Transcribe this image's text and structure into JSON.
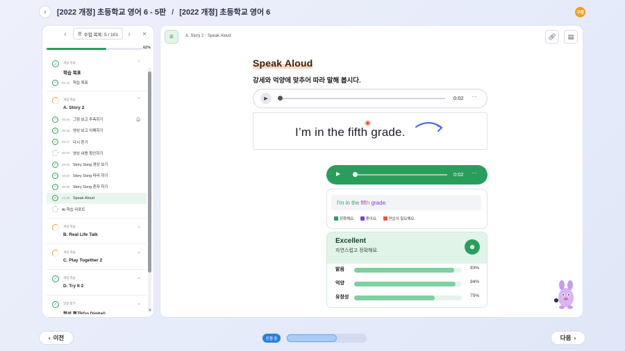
{
  "header": {
    "title_left": "[2022 개정] 초등학교 영어 6 - 5판",
    "title_right": "[2022 개정] 초등학교 영어 6",
    "separator": "/",
    "user_badge": "구름"
  },
  "sidebar": {
    "counter_label": "수업 목록: 5 / 101",
    "progress_percent": "62%",
    "progress_value": 0.62,
    "sections": [
      {
        "type": "개념 학습",
        "title": "학습 목표",
        "status": "complete",
        "items": [
          {
            "time": "00:16",
            "label": "학습 목표",
            "status": "complete"
          }
        ]
      },
      {
        "type": "개념 학습",
        "title": "A. Story 2",
        "status": "partial",
        "items": [
          {
            "time": "00:06",
            "label": "그림 보고 추측하기",
            "status": "complete",
            "extra": "headphone"
          },
          {
            "time": "00:36",
            "label": "영상 보고 이해하기",
            "status": "complete"
          },
          {
            "time": "00:17",
            "label": "다시 듣기",
            "status": "complete"
          },
          {
            "time": "00:03",
            "label": "영상 내용 확인하기",
            "status": "todo"
          },
          {
            "time": "00:00",
            "label": "Story Song 영상 보기",
            "status": "complete"
          },
          {
            "time": "00:00",
            "label": "Story Song 따라 하기",
            "status": "complete"
          },
          {
            "time": "00:00",
            "label": "Story Song 혼자 하기",
            "status": "complete"
          },
          {
            "time": "01:36",
            "label": "Speak Aloud",
            "status": "complete",
            "active": true
          },
          {
            "time": "",
            "label": "AI 학습 리포트",
            "status": "todo"
          }
        ]
      },
      {
        "type": "개념 학습",
        "title": "B. Real Life Talk",
        "status": "partial",
        "items": []
      },
      {
        "type": "개념 학습",
        "title": "C. Play Together 2",
        "status": "partial",
        "items": []
      },
      {
        "type": "개념 학습",
        "title": "D. Try It 2",
        "status": "complete",
        "items": []
      },
      {
        "type": "일정 평가",
        "title": "형성 평가(Go Digital)",
        "status": "complete",
        "items": []
      }
    ]
  },
  "main": {
    "breadcrumb": [
      "A. Story 2",
      "Speak Aloud"
    ],
    "breadcrumb_sep": "/",
    "title": "Speak Aloud",
    "subtitle": "강세와 억양에 맞추어 따라 말해 봅시다.",
    "audio_reference": {
      "time": "0:02",
      "more": "···"
    },
    "sentence": "I’m in the fifth grade.",
    "audio_recording": {
      "time": "0:02",
      "more": "···"
    },
    "result": {
      "part1": "I'm in the ",
      "part2": "fif",
      "part3": "th",
      "part4": " grade.",
      "legend": [
        {
          "label": "정확해요.",
          "color": "#2a9d5c"
        },
        {
          "label": "좋아요.",
          "color": "#7a3fc8"
        },
        {
          "label": "연습이 필요해요.",
          "color": "#e9593f"
        }
      ]
    },
    "score": {
      "title": "Excellent",
      "subtitle": "자연스럽고 정확해요.",
      "metrics": [
        {
          "label": "발음",
          "value": 93,
          "display": "93%"
        },
        {
          "label": "억양",
          "value": 94,
          "display": "94%"
        },
        {
          "label": "유창성",
          "value": 75,
          "display": "75%"
        }
      ]
    }
  },
  "footer": {
    "prev_label": "이전",
    "next_label": "다음",
    "status_label": "진행 중"
  },
  "colors": {
    "accent_green": "#2a9d5c",
    "accent_orange": "#f39c1e",
    "accent_blue": "#2a7fe0"
  }
}
